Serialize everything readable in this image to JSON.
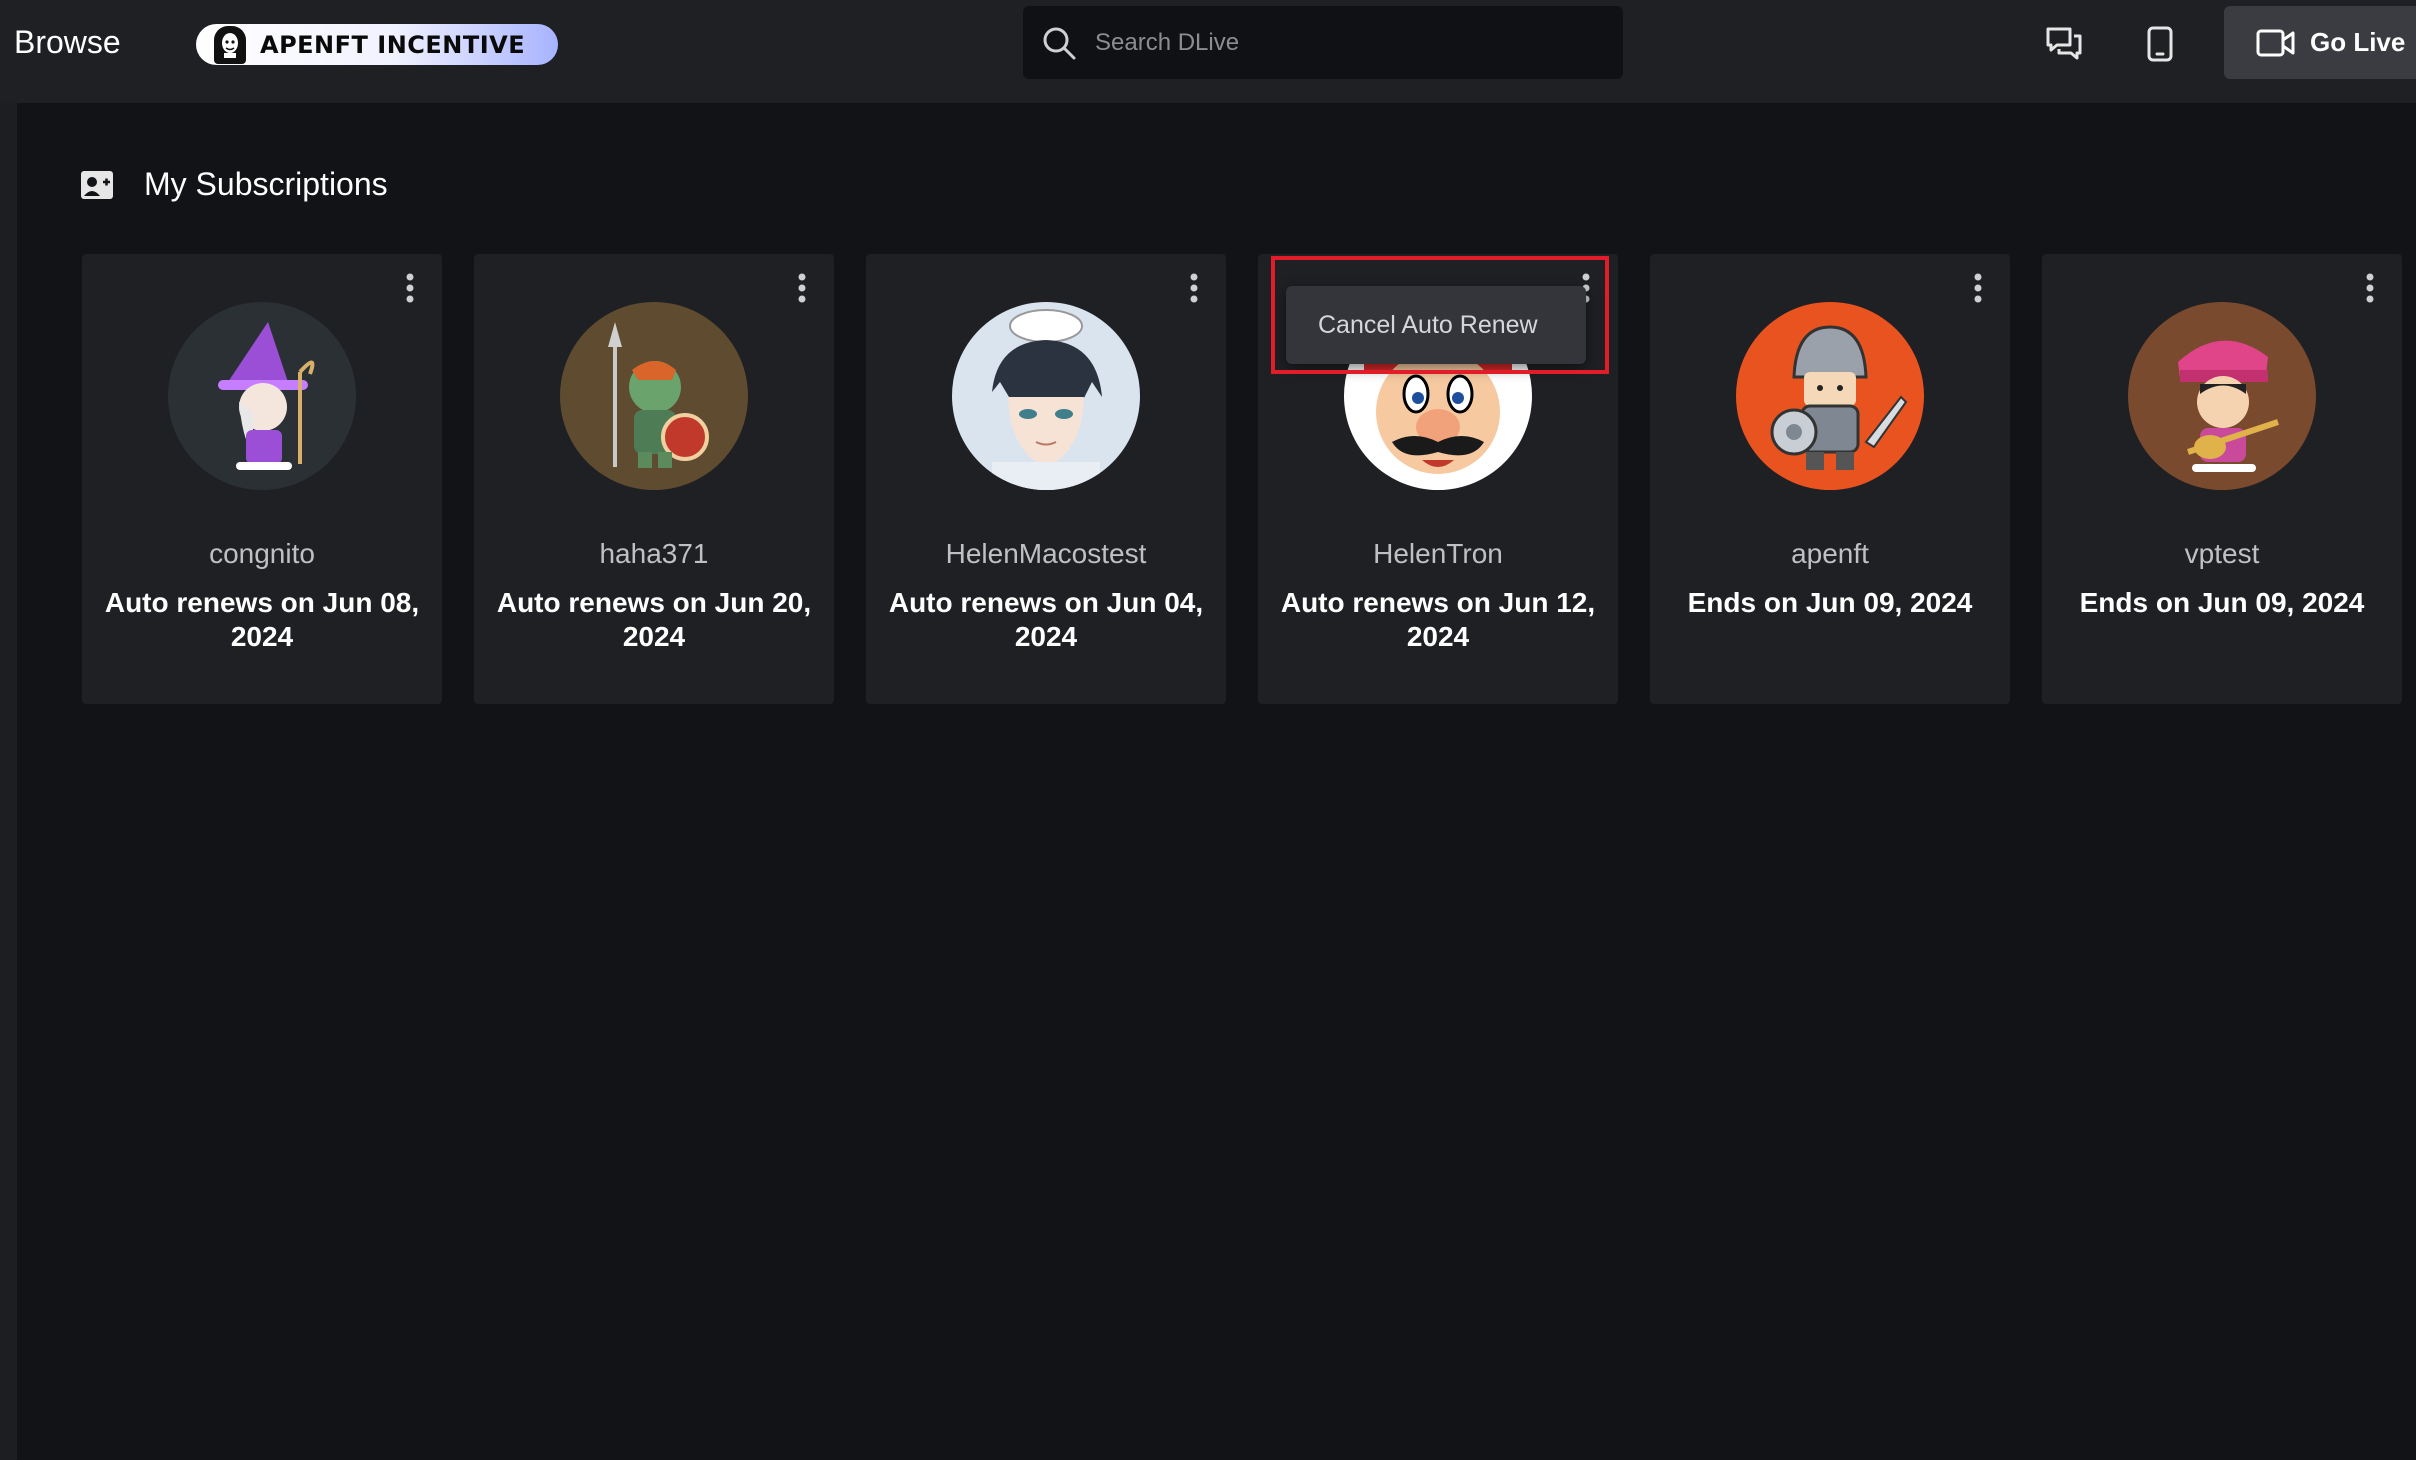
{
  "header": {
    "browse_label": "Browse",
    "promo_label": "APENFT INCENTIVE",
    "search_placeholder": "Search DLive",
    "go_live_label": "Go Live",
    "icons": [
      "search-icon",
      "chat-icon",
      "mobile-icon",
      "camera-icon"
    ]
  },
  "section": {
    "title": "My Subscriptions",
    "icon": "subscriptions-icon"
  },
  "subscriptions": [
    {
      "name": "congnito",
      "status": "Auto renews on Jun 08, 2024",
      "avatar_bg": "#2a3034"
    },
    {
      "name": "haha371",
      "status": "Auto renews on Jun 20, 2024",
      "avatar_bg": "#5e4b30"
    },
    {
      "name": "HelenMacostest",
      "status": "Auto renews on Jun 04, 2024",
      "avatar_bg": "#d9e4ef"
    },
    {
      "name": "HelenTron",
      "status": "Auto renews on Jun 12, 2024",
      "avatar_bg": "#ffffff"
    },
    {
      "name": "apenft",
      "status": "Ends on Jun 09, 2024",
      "avatar_bg": "#e8531f"
    },
    {
      "name": "vptest",
      "status": "Ends on Jun 09, 2024",
      "avatar_bg": "#7a4a2e"
    }
  ],
  "context_menu": {
    "item_label": "Cancel Auto Renew"
  },
  "colors": {
    "background": "#121316",
    "card": "#1f2024",
    "highlight": "#e11d2a"
  }
}
